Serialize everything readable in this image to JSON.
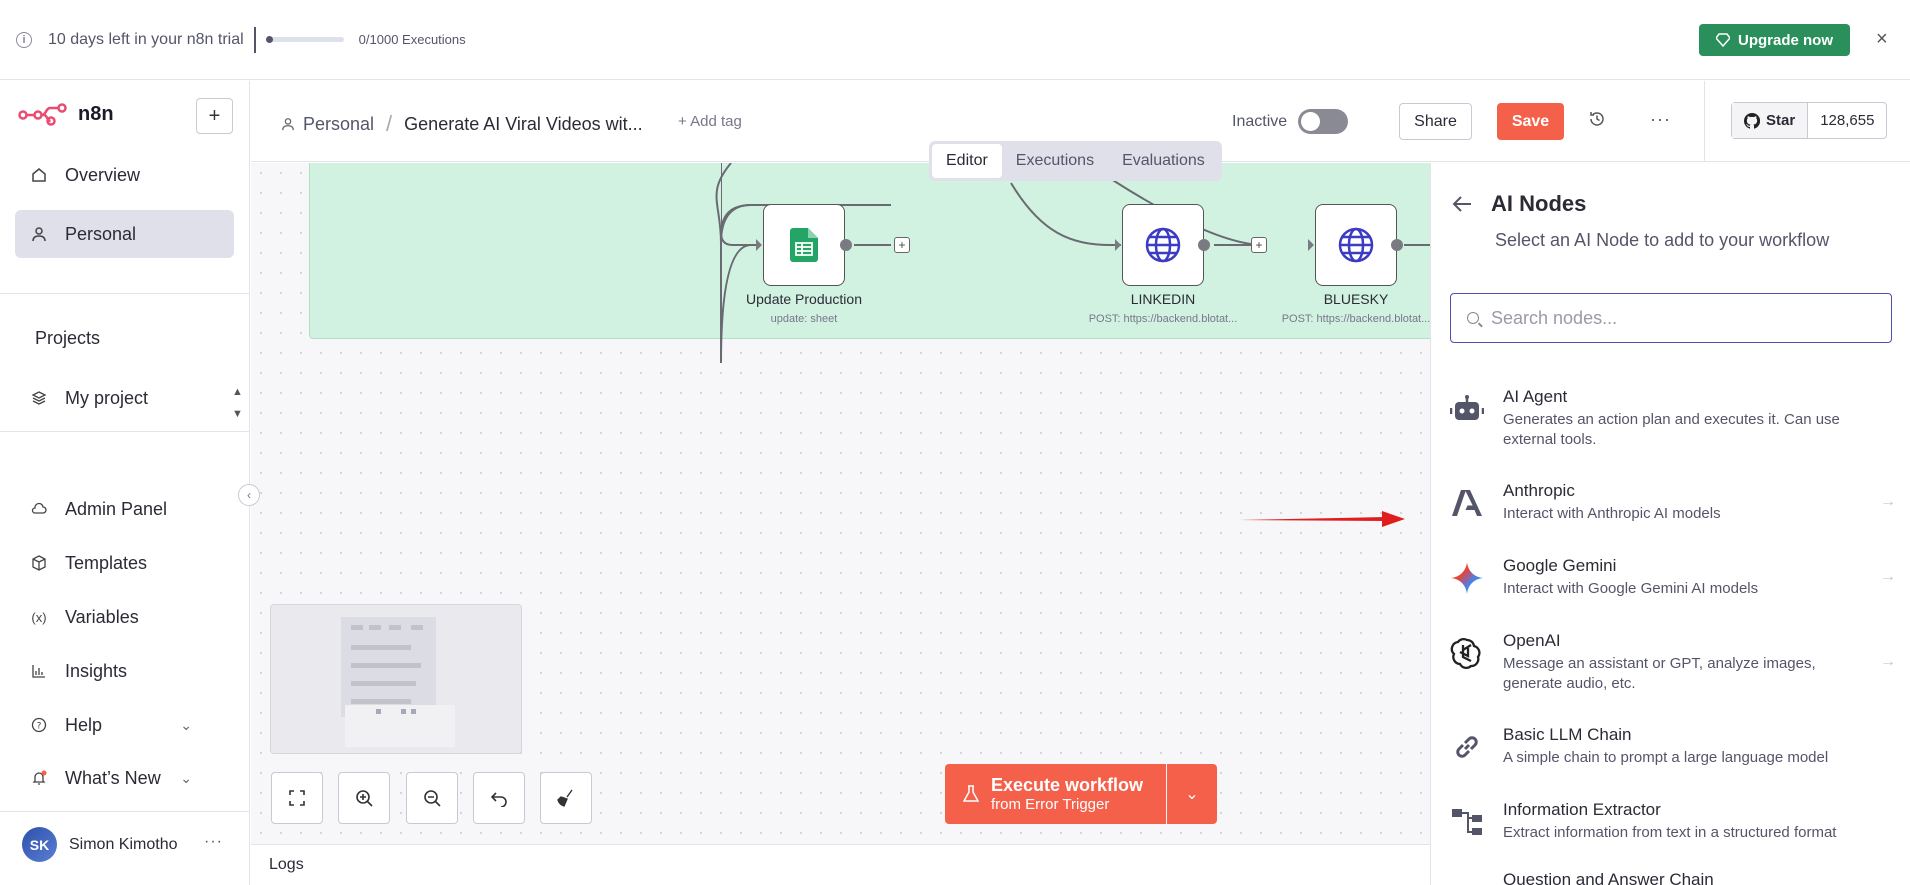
{
  "banner": {
    "trial_text": "10 days left in your n8n trial",
    "executions": "0/1000 Executions",
    "execution_progress": 0,
    "upgrade_label": "Upgrade now",
    "close_label": "×"
  },
  "sidebar": {
    "brand": "n8n",
    "overview": "Overview",
    "personal": "Personal",
    "projects_heading": "Projects",
    "my_project": "My project",
    "admin_panel": "Admin Panel",
    "templates": "Templates",
    "variables": "Variables",
    "insights": "Insights",
    "help": "Help",
    "whats_new": "What’s New",
    "user_initials": "SK",
    "user_name": "Simon Kimotho"
  },
  "header": {
    "crumb_personal": "Personal",
    "workflow_name": "Generate AI Viral Videos wit...",
    "add_tag": "+ Add tag",
    "status": "Inactive",
    "share": "Share",
    "save": "Save",
    "github_star": "Star",
    "github_count": "128,655"
  },
  "tabs": [
    "Editor",
    "Executions",
    "Evaluations"
  ],
  "canvas": {
    "nodes": [
      {
        "label": "Update Production",
        "sub": "update: sheet"
      },
      {
        "label": "LINKEDIN",
        "sub": "POST: https://backend.blotat..."
      },
      {
        "label": "BLUESKY",
        "sub": "POST: https://backend.blotat..."
      }
    ],
    "execute_label": "Execute workflow",
    "execute_sub": "from Error Trigger",
    "logs": "Logs"
  },
  "panel": {
    "title": "AI Nodes",
    "subtitle": "Select an AI Node to add to your workflow",
    "search_placeholder": "Search nodes...",
    "items": [
      {
        "name": "AI Agent",
        "desc": "Generates an action plan and executes it. Can use external tools."
      },
      {
        "name": "Anthropic",
        "desc": "Interact with Anthropic AI models"
      },
      {
        "name": "Google Gemini",
        "desc": "Interact with Google Gemini AI models"
      },
      {
        "name": "OpenAI",
        "desc": "Message an assistant or GPT, analyze images, generate audio, etc."
      },
      {
        "name": "Basic LLM Chain",
        "desc": "A simple chain to prompt a large language model"
      },
      {
        "name": "Information Extractor",
        "desc": "Extract information from text in a structured format"
      },
      {
        "name": "Question and Answer Chain",
        "desc": ""
      }
    ]
  },
  "colors": {
    "accent": "#f5604a",
    "upgrade": "#2a8f5a",
    "sticky": "#d2f2e1",
    "selection": "#4f4fb0"
  }
}
